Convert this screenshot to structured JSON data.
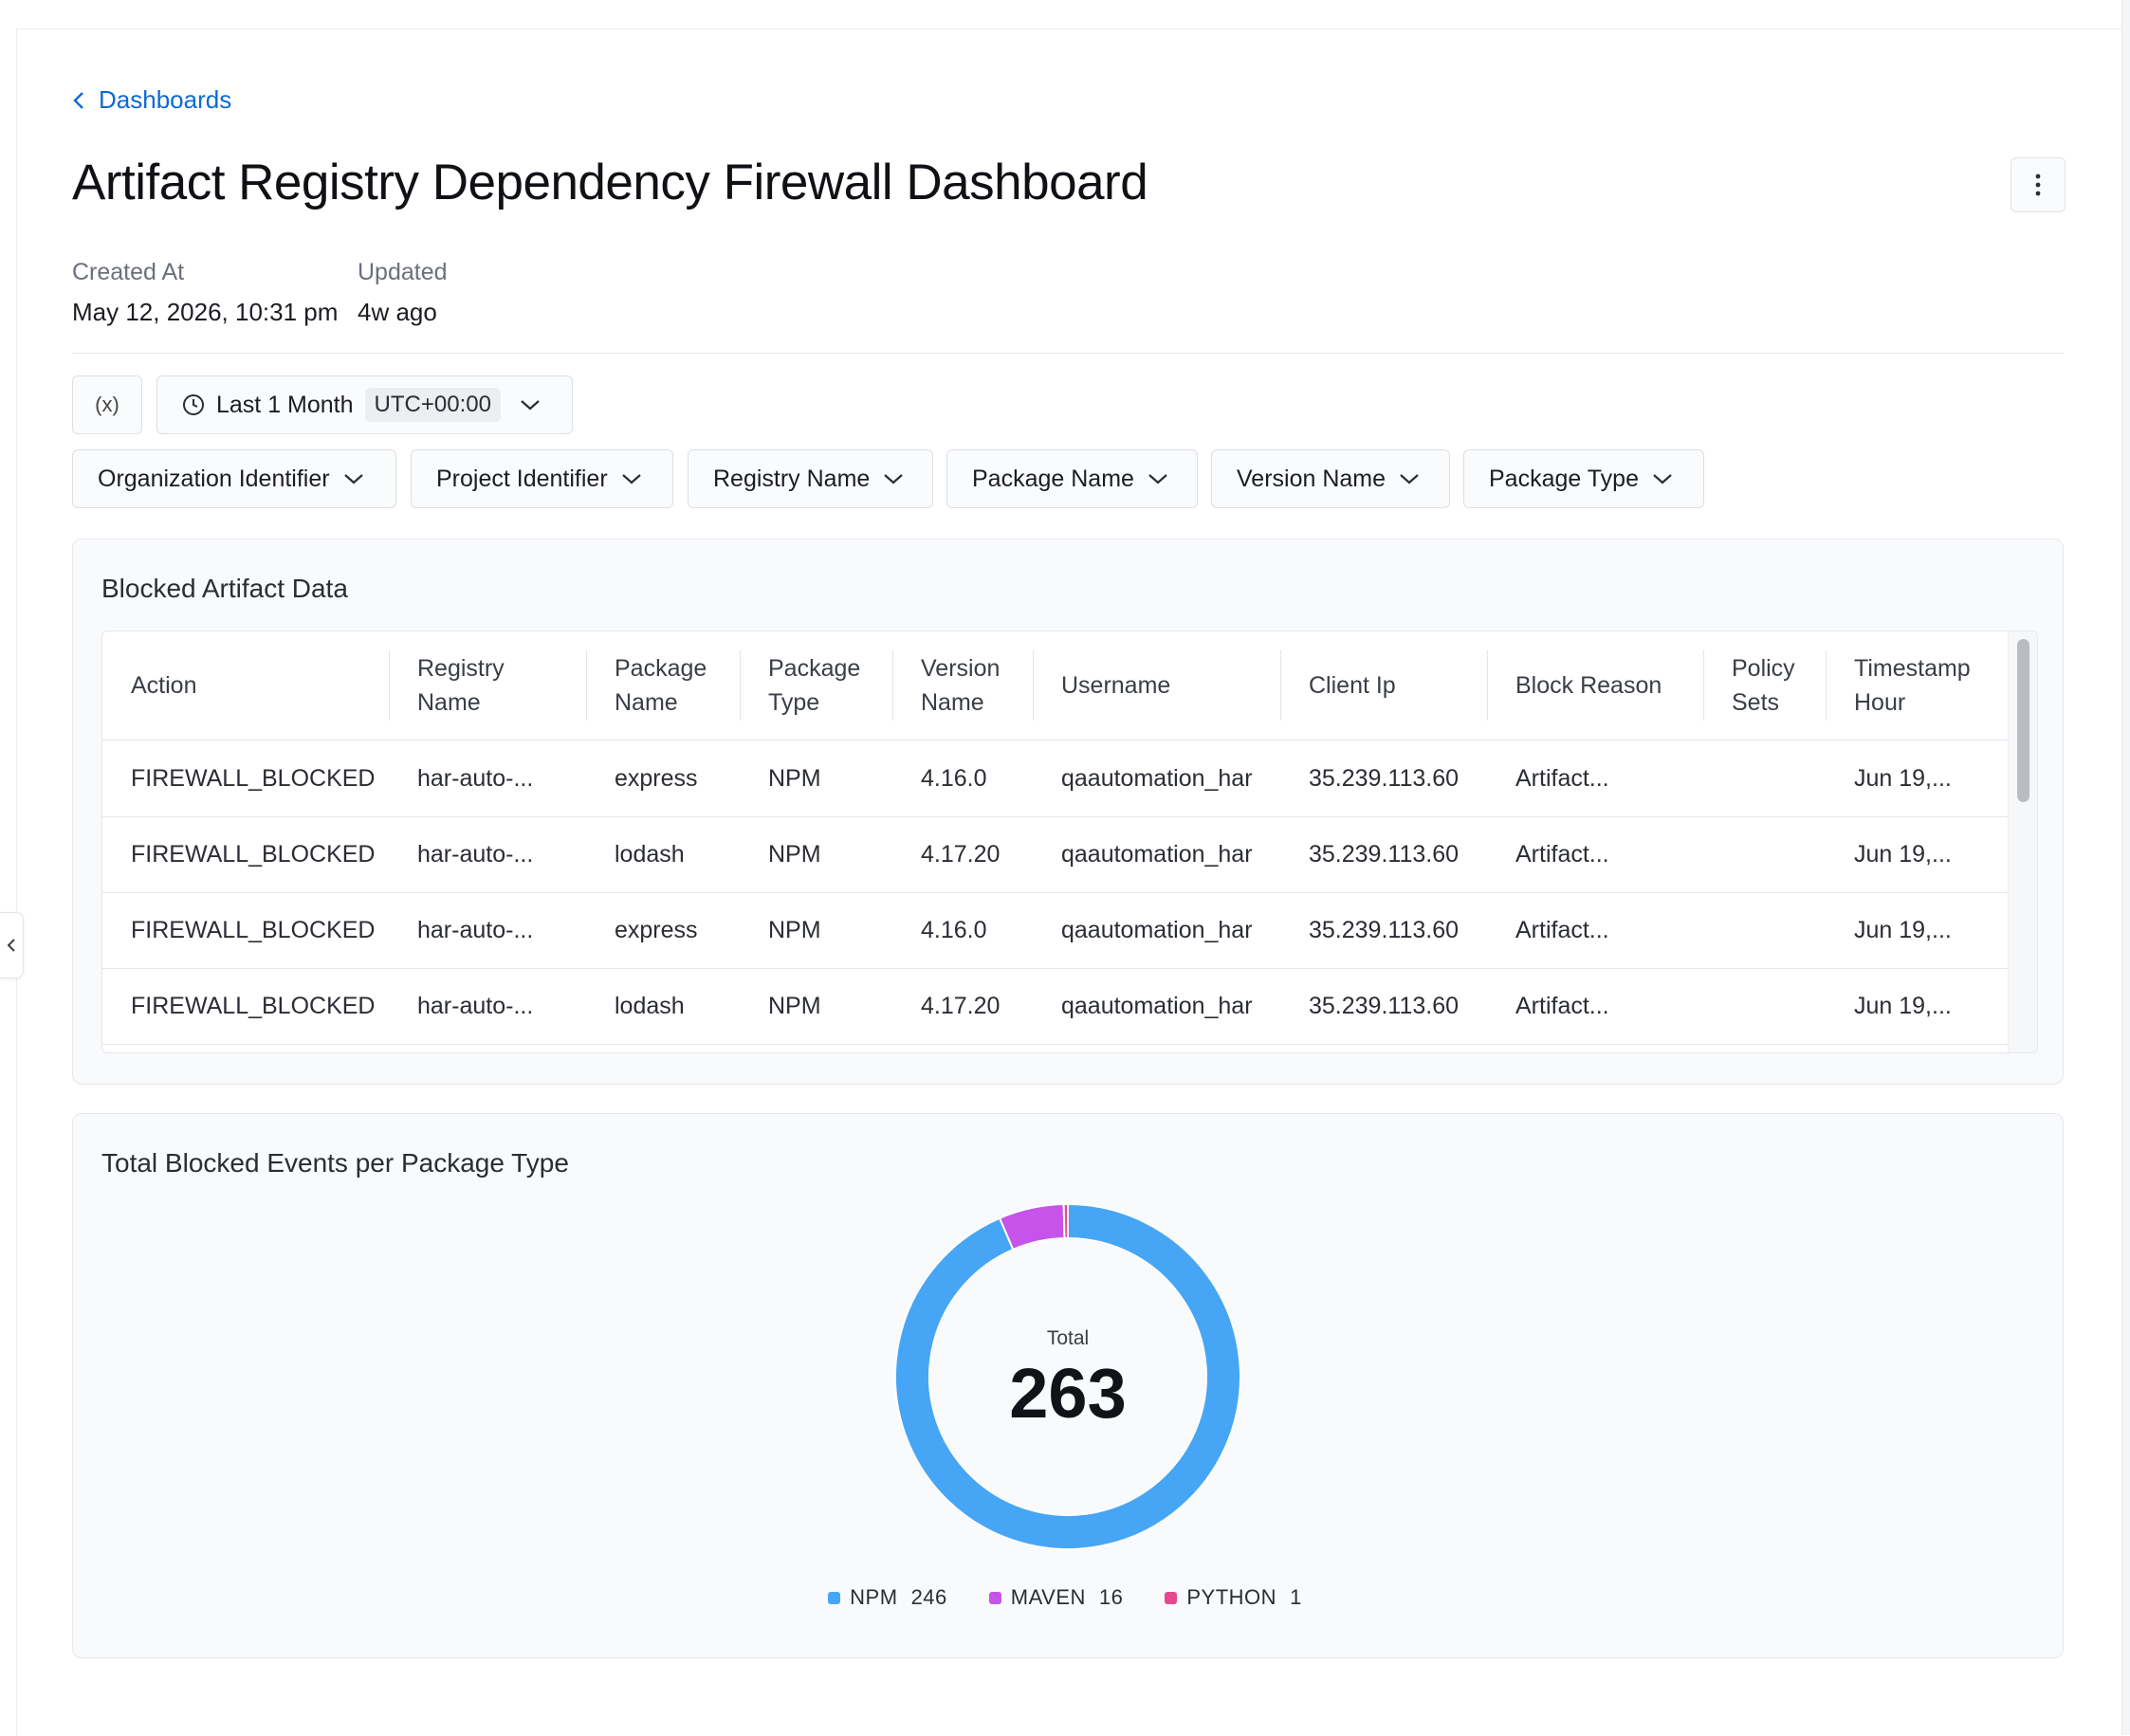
{
  "breadcrumb": {
    "label": "Dashboards"
  },
  "title": "Artifact Registry Dependency Firewall Dashboard",
  "meta": {
    "created_label": "Created At",
    "created_value": "May 12, 2026, 10:31 pm",
    "updated_label": "Updated",
    "updated_value": "4w ago"
  },
  "toolbar": {
    "variables_label": "(x)",
    "time_range": "Last 1 Month",
    "timezone": "UTC+00:00"
  },
  "filters": [
    "Organization Identifier",
    "Project Identifier",
    "Registry Name",
    "Package Name",
    "Version Name",
    "Package Type"
  ],
  "table_card": {
    "title": "Blocked Artifact Data",
    "columns": [
      {
        "line1": "Action",
        "line2": ""
      },
      {
        "line1": "Registry",
        "line2": "Name"
      },
      {
        "line1": "Package",
        "line2": "Name"
      },
      {
        "line1": "Package",
        "line2": "Type"
      },
      {
        "line1": "Version",
        "line2": "Name"
      },
      {
        "line1": "Username",
        "line2": ""
      },
      {
        "line1": "Client Ip",
        "line2": ""
      },
      {
        "line1": "Block Reason",
        "line2": ""
      },
      {
        "line1": "Policy",
        "line2": "Sets"
      },
      {
        "line1": "Timestamp",
        "line2": "Hour"
      }
    ],
    "rows": [
      [
        "FIREWALL_BLOCKED",
        "har-auto-...",
        "express",
        "NPM",
        "4.16.0",
        "qaautomation_har",
        "35.239.113.60",
        "Artifact...",
        "",
        "Jun 19,..."
      ],
      [
        "FIREWALL_BLOCKED",
        "har-auto-...",
        "lodash",
        "NPM",
        "4.17.20",
        "qaautomation_har",
        "35.239.113.60",
        "Artifact...",
        "",
        "Jun 19,..."
      ],
      [
        "FIREWALL_BLOCKED",
        "har-auto-...",
        "express",
        "NPM",
        "4.16.0",
        "qaautomation_har",
        "35.239.113.60",
        "Artifact...",
        "",
        "Jun 19,..."
      ],
      [
        "FIREWALL_BLOCKED",
        "har-auto-...",
        "lodash",
        "NPM",
        "4.17.20",
        "qaautomation_har",
        "35.239.113.60",
        "Artifact...",
        "",
        "Jun 19,..."
      ]
    ]
  },
  "chart_card": {
    "title": "Total Blocked Events per Package Type",
    "center_label": "Total",
    "center_value": "263"
  },
  "chart_data": {
    "type": "pie",
    "title": "Total Blocked Events per Package Type",
    "categories": [
      "NPM",
      "MAVEN",
      "PYTHON"
    ],
    "values": [
      246,
      16,
      1
    ],
    "colors": [
      "#46a6f5",
      "#c653ea",
      "#e6498f"
    ],
    "legend": "bottom",
    "donut": true
  }
}
